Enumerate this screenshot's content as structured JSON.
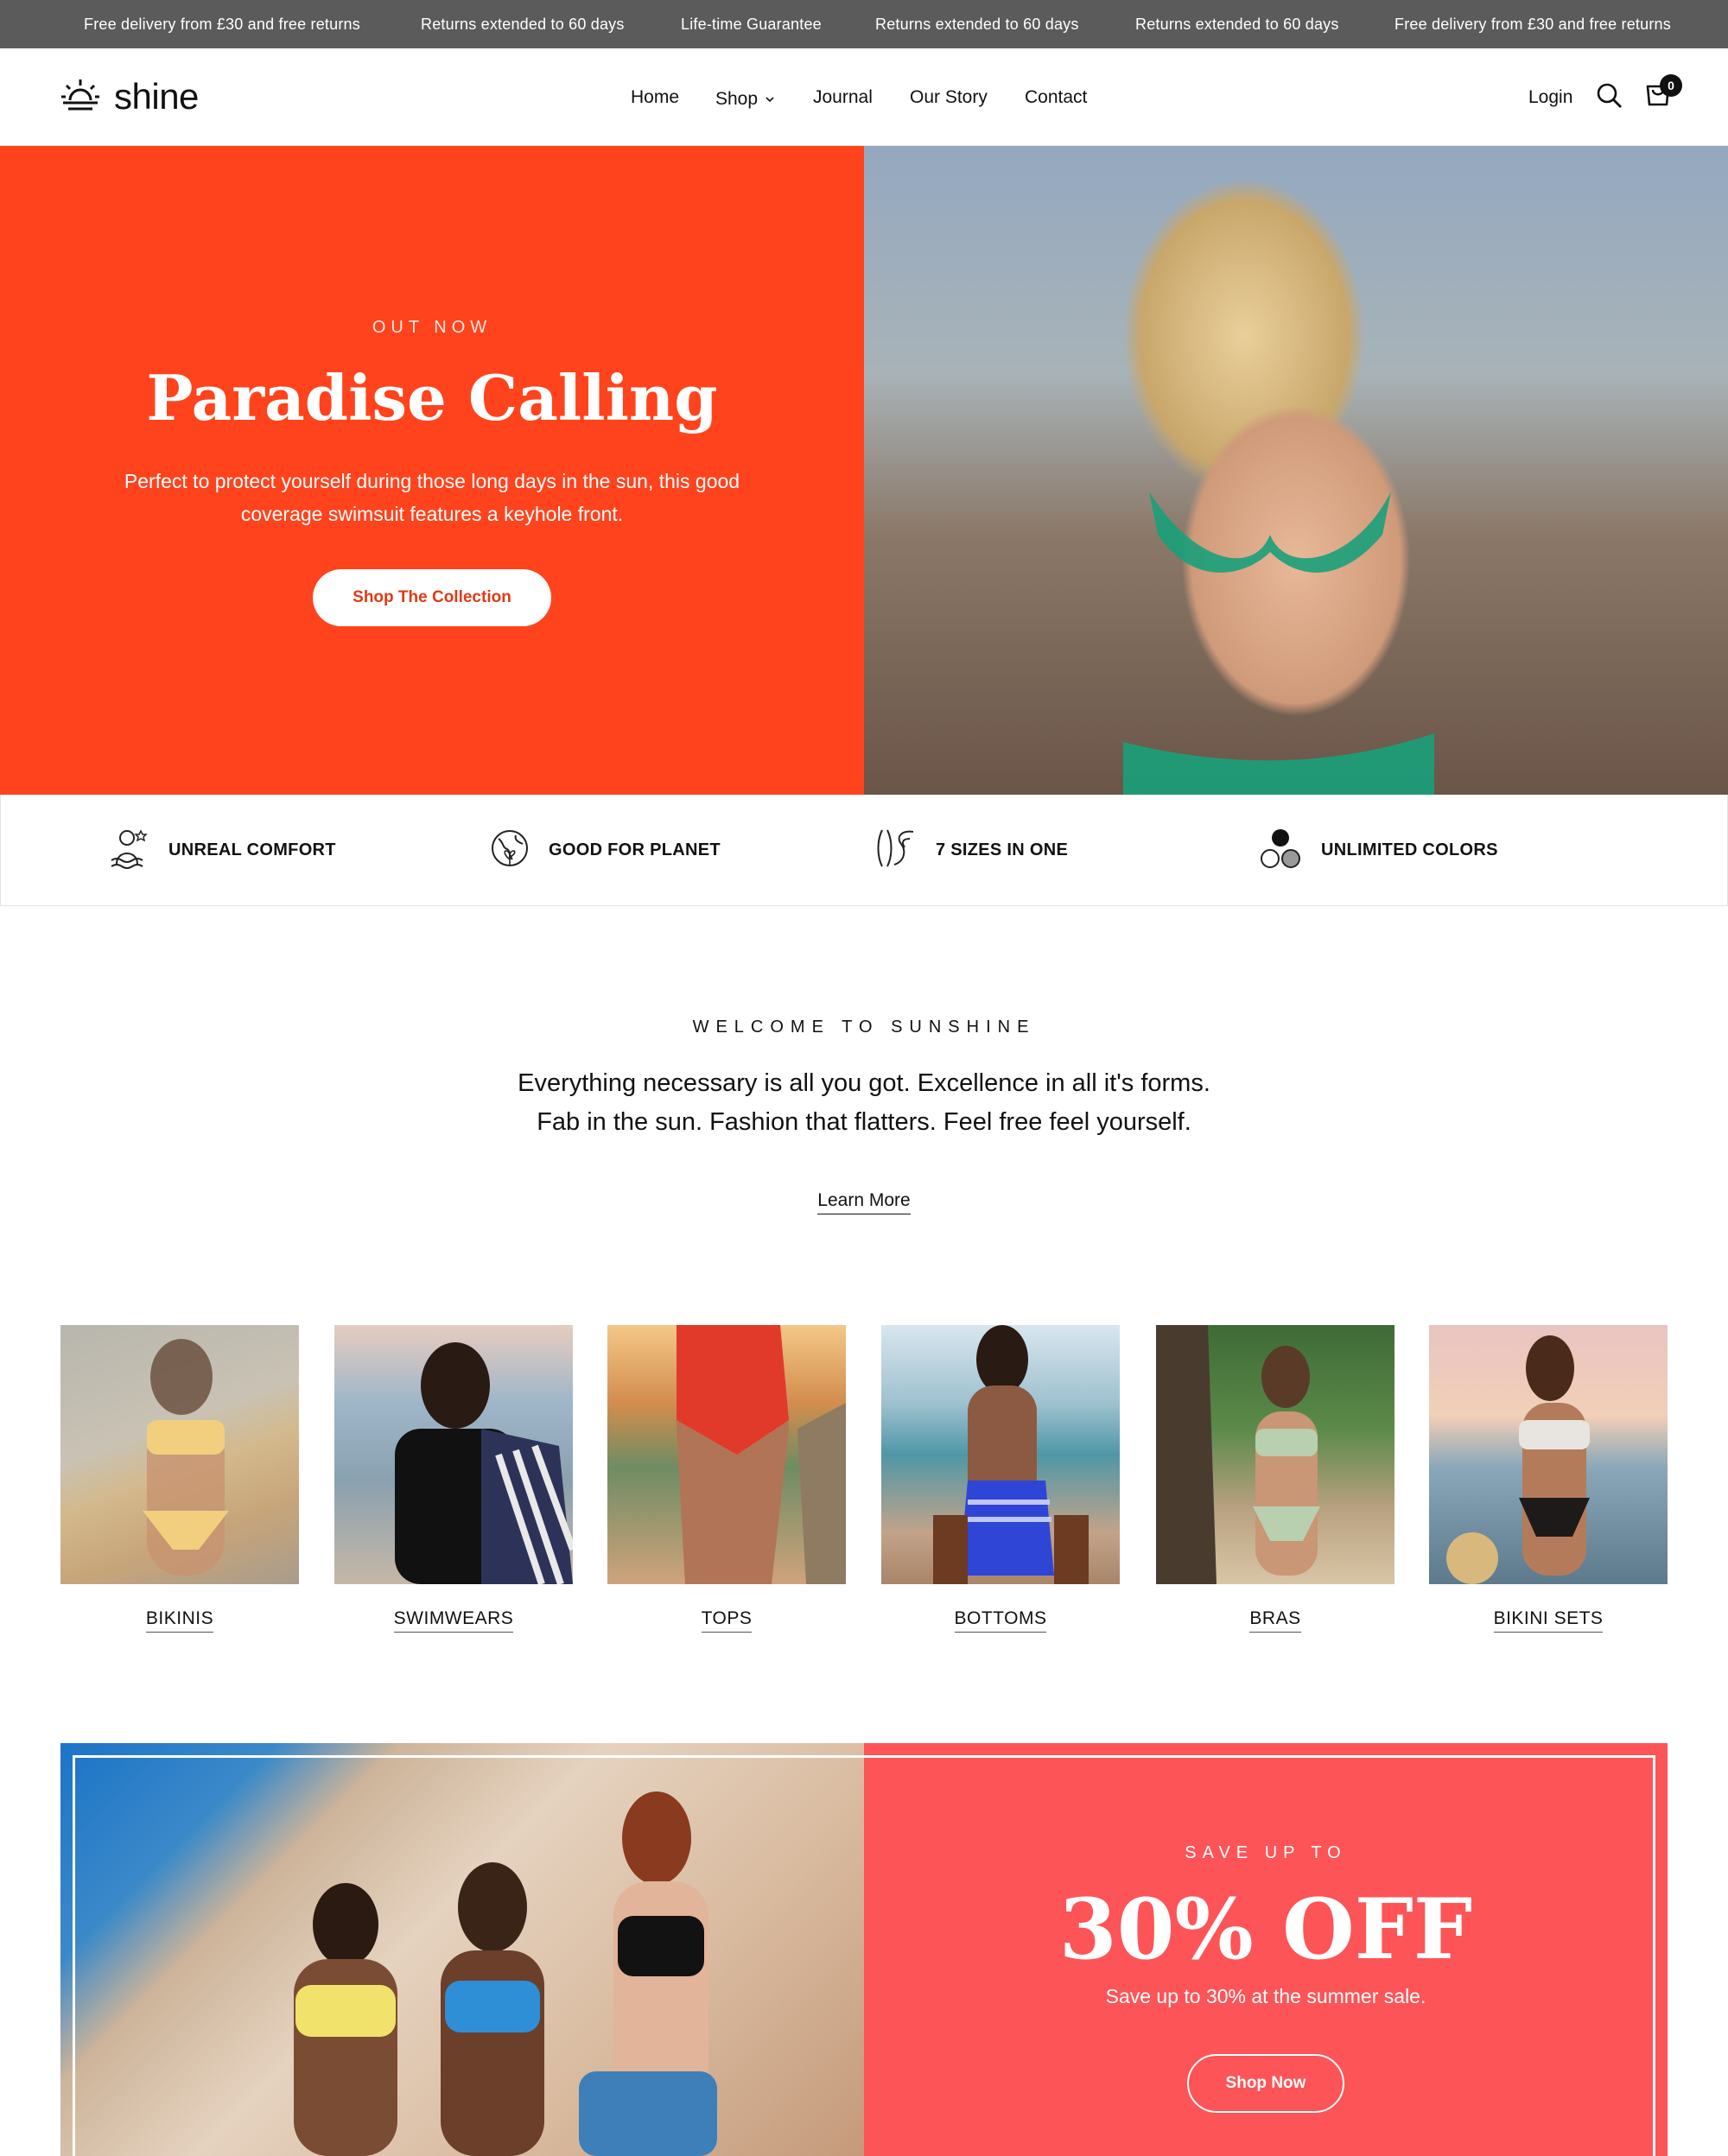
{
  "announcement": {
    "messages": [
      "Free delivery from £30 and free returns",
      "Returns extended to 60 days",
      "Life-time Guarantee",
      "Returns extended to 60 days",
      "Returns extended to 60 days",
      "Free delivery from £30 and free returns"
    ]
  },
  "header": {
    "logo_text": "shine",
    "logo_icon": "sunrise-icon",
    "nav": [
      "Home",
      "Shop",
      "Journal",
      "Our Story",
      "Contact"
    ],
    "login_label": "Login",
    "search_icon": "search-icon",
    "cart_icon": "cart-icon",
    "cart_count": "0"
  },
  "hero": {
    "eyebrow": "OUT NOW",
    "title": "Paradise Calling",
    "description": "Perfect to protect yourself during those long days in the sun, this good coverage swimsuit features a keyhole front.",
    "button_label": "Shop The Collection",
    "background_color": "#ff431d"
  },
  "features": [
    {
      "label": "UNREAL COMFORT",
      "icon": "comfort-icon"
    },
    {
      "label": "GOOD FOR PLANET",
      "icon": "planet-icon"
    },
    {
      "label": "7 SIZES IN ONE",
      "icon": "sizes-icon"
    },
    {
      "label": "UNLIMITED COLORS",
      "icon": "colors-icon"
    }
  ],
  "welcome": {
    "eyebrow": "WELCOME TO SUNSHINE",
    "line1": "Everything necessary is all you got. Excellence in all it's forms.",
    "line2": "Fab in the sun. Fashion that flatters. Feel free feel yourself.",
    "link_label": "Learn More"
  },
  "categories": [
    {
      "name": "BIKINIS"
    },
    {
      "name": "SWIMWEARS"
    },
    {
      "name": "TOPS"
    },
    {
      "name": "BOTTOMS"
    },
    {
      "name": "BRAS"
    },
    {
      "name": "BIKINI SETS"
    }
  ],
  "promo": {
    "eyebrow": "SAVE UP TO",
    "title": "30% OFF",
    "description": "Save up to 30% at the summer sale.",
    "button_label": "Shop Now",
    "background_color": "#fd5458"
  }
}
